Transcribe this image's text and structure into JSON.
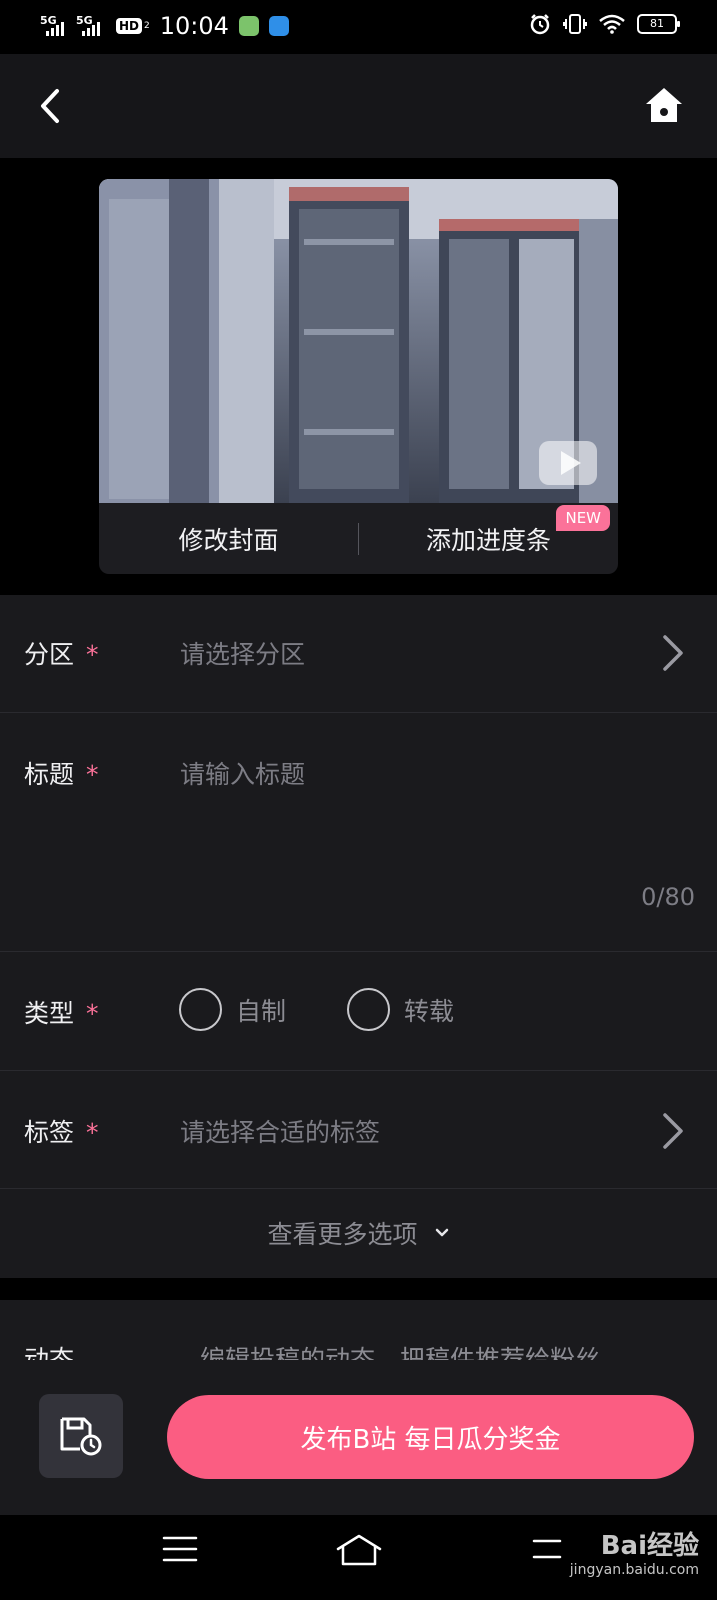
{
  "status_bar": {
    "signal_1": "5G",
    "signal_2": "5G",
    "hd_label": "HD",
    "hd_sub": "2",
    "time": "10:04",
    "battery": "81"
  },
  "header": {
    "back_icon": "chevron-left-icon",
    "home_icon": "home-icon"
  },
  "cover": {
    "edit_cover_label": "修改封面",
    "add_progress_label": "添加进度条",
    "new_badge": "NEW",
    "play_icon": "tv-play-icon"
  },
  "form": {
    "category": {
      "label": "分区",
      "required_mark": "*",
      "placeholder": "请选择分区"
    },
    "title": {
      "label": "标题",
      "required_mark": "*",
      "placeholder": "请输入标题",
      "counter": "0/80"
    },
    "type": {
      "label": "类型",
      "required_mark": "*",
      "options": [
        "自制",
        "转载"
      ],
      "selected": null
    },
    "tags": {
      "label": "标签",
      "required_mark": "*",
      "placeholder": "请选择合适的标签"
    },
    "more_options": "查看更多选项"
  },
  "dynamic": {
    "label": "动态",
    "placeholder": "编辑投稿的动态，把稿件推荐给粉丝"
  },
  "bottom_bar": {
    "draft_icon": "save-draft-clock-icon",
    "publish_label": "发布B站 每日瓜分奖金"
  },
  "watermark": {
    "main": "Bai经验",
    "sub": "jingyan.baidu.com"
  },
  "colors": {
    "accent": "#fb7299",
    "publish": "#fb5d82",
    "background": "#1a1a1d"
  }
}
